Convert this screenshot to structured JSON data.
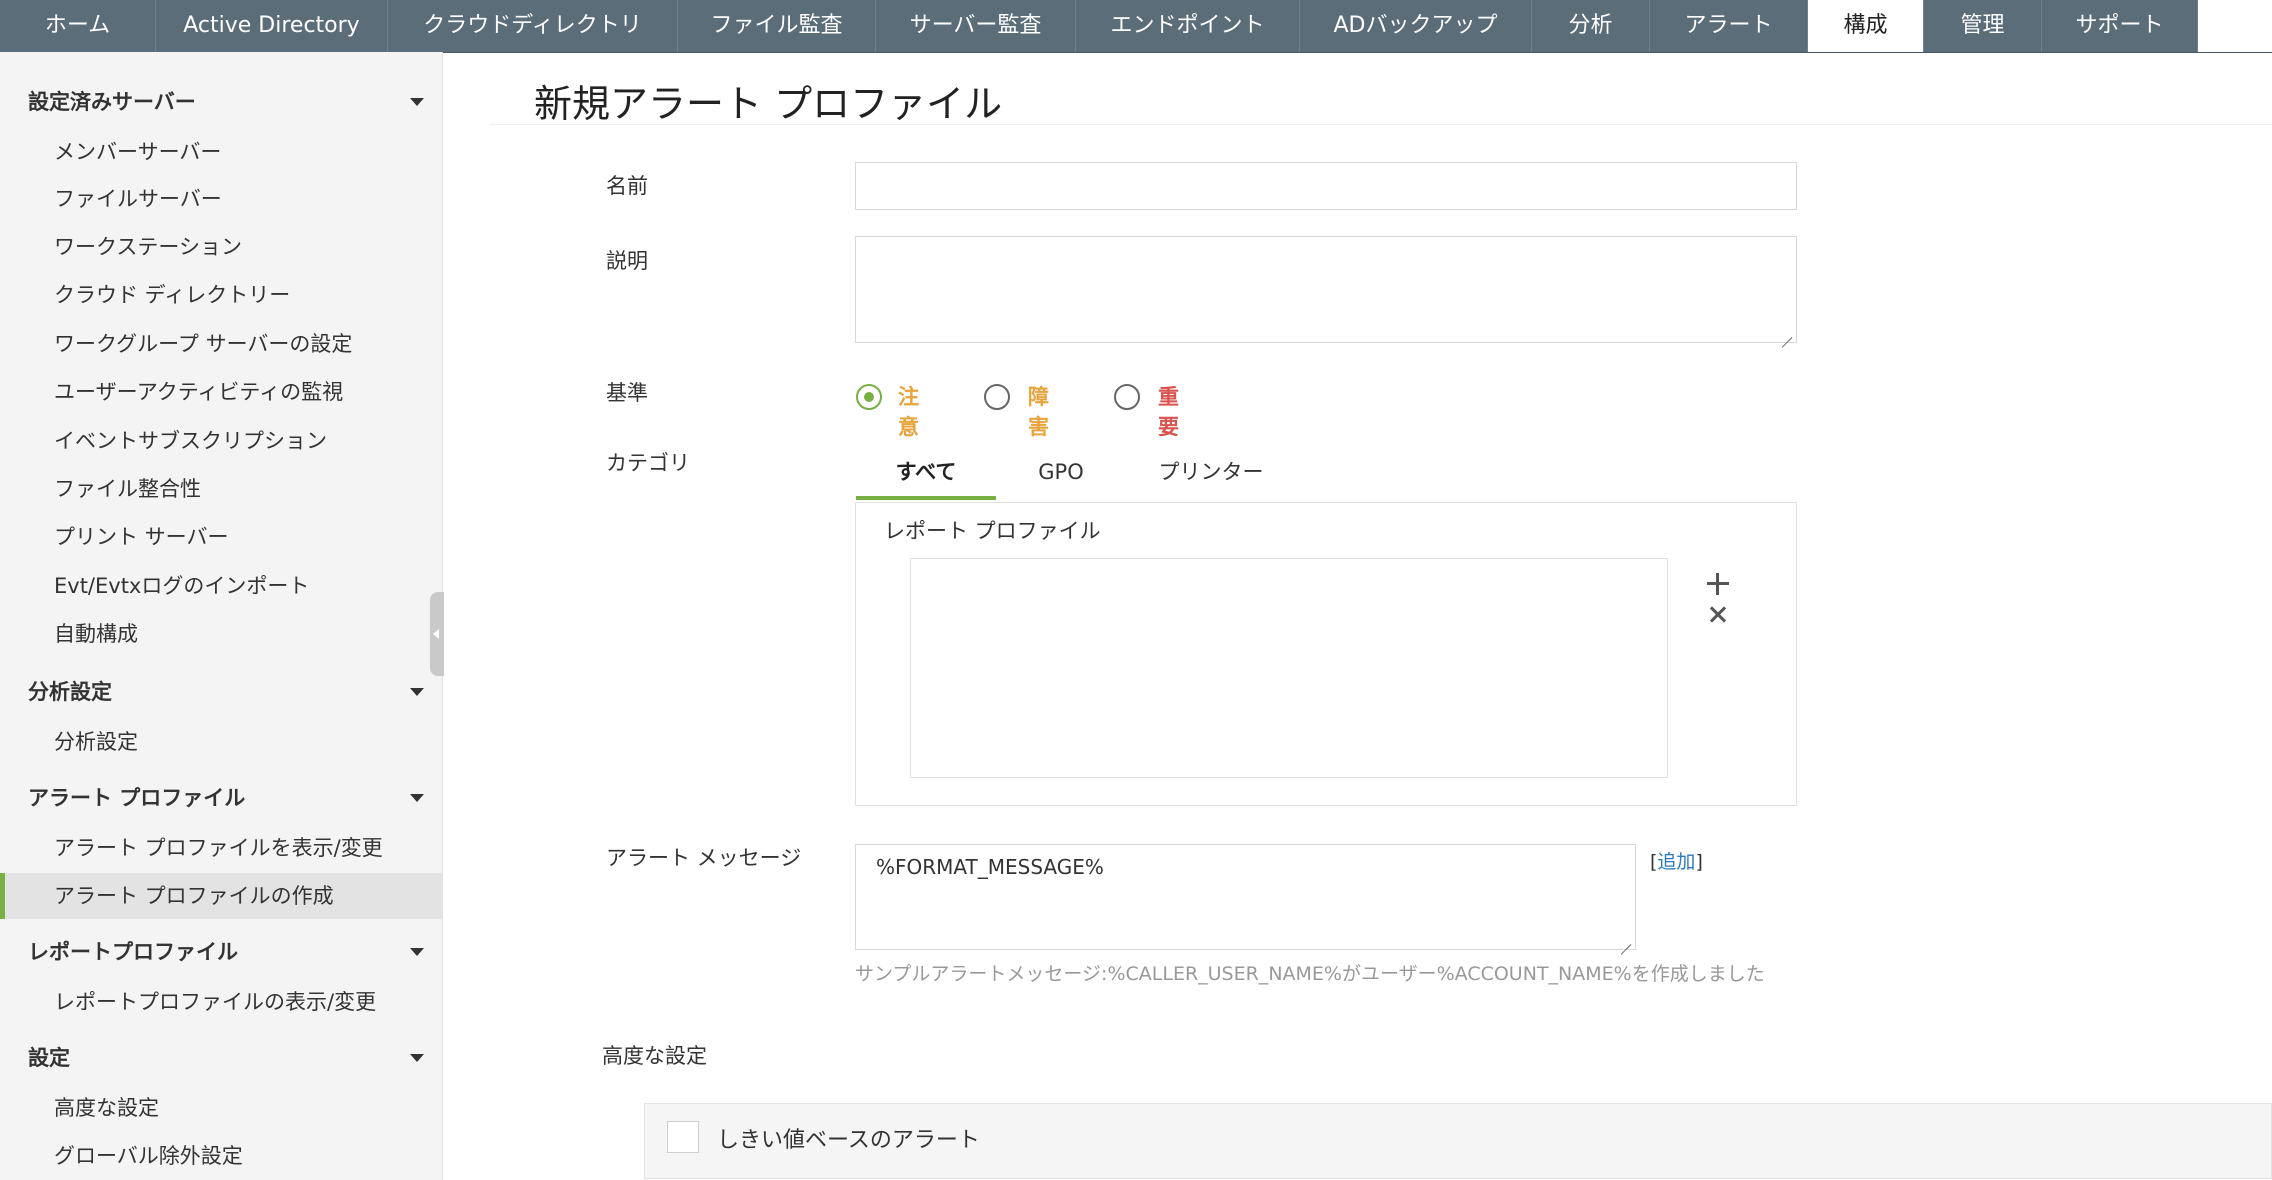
{
  "topnav": {
    "tabs": [
      {
        "label": "ホーム"
      },
      {
        "label": "Active Directory"
      },
      {
        "label": "クラウドディレクトリ"
      },
      {
        "label": "ファイル監査"
      },
      {
        "label": "サーバー監査"
      },
      {
        "label": "エンドポイント"
      },
      {
        "label": "ADバックアップ"
      },
      {
        "label": "分析"
      },
      {
        "label": "アラート"
      },
      {
        "label": "構成"
      },
      {
        "label": "管理"
      },
      {
        "label": "サポート"
      }
    ],
    "active_tab": "構成"
  },
  "sidebar": {
    "sections": [
      {
        "title": "設定済みサーバー",
        "items": [
          "メンバーサーバー",
          "ファイルサーバー",
          "ワークステーション",
          "クラウド ディレクトリー",
          "ワークグループ サーバーの設定",
          "ユーザーアクティビティの監視",
          "イベントサブスクリプション",
          "ファイル整合性",
          "プリント サーバー",
          "Evt/Evtxログのインポート",
          "自動構成"
        ]
      },
      {
        "title": "分析設定",
        "items": [
          "分析設定"
        ]
      },
      {
        "title": "アラート プロファイル",
        "items": [
          "アラート プロファイルを表示/変更",
          "アラート プロファイルの作成"
        ]
      },
      {
        "title": "レポートプロファイル",
        "items": [
          "レポートプロファイルの表示/変更"
        ]
      },
      {
        "title": "設定",
        "items": [
          "高度な設定",
          "グローバル除外設定"
        ]
      }
    ],
    "active_item": "アラート プロファイルの作成"
  },
  "main": {
    "title": "新規アラート プロファイル",
    "name_label": "名前",
    "name_value": "",
    "description_label": "説明",
    "description_value": "",
    "criteria_label": "基準",
    "criteria_options": [
      {
        "label": "注意",
        "selected": true,
        "color": "#e8a33d"
      },
      {
        "label": "障害",
        "selected": false,
        "color": "#e8a33d"
      },
      {
        "label": "重要",
        "selected": false,
        "color": "#d9534f"
      }
    ],
    "category_label": "カテゴリ",
    "category_tabs": [
      "すべて",
      "GPO",
      "プリンター"
    ],
    "category_active": "すべて",
    "report_profile_title": "レポート プロファイル",
    "alert_message_label": "アラート メッセージ",
    "alert_message_value": "%FORMAT_MESSAGE%",
    "add_bracket_open": "[",
    "add_link": "追加",
    "add_bracket_close": "]",
    "sample_hint": "サンプルアラートメッセージ:%CALLER_USER_NAME%がユーザー%ACCOUNT_NAME%を作成しました",
    "advanced_label": "高度な設定",
    "threshold_label": "しきい値ベースのアラート"
  },
  "colors": {
    "nav_bg": "#5b6d79",
    "accent_green": "#78b043",
    "link_blue": "#2a79c2"
  }
}
